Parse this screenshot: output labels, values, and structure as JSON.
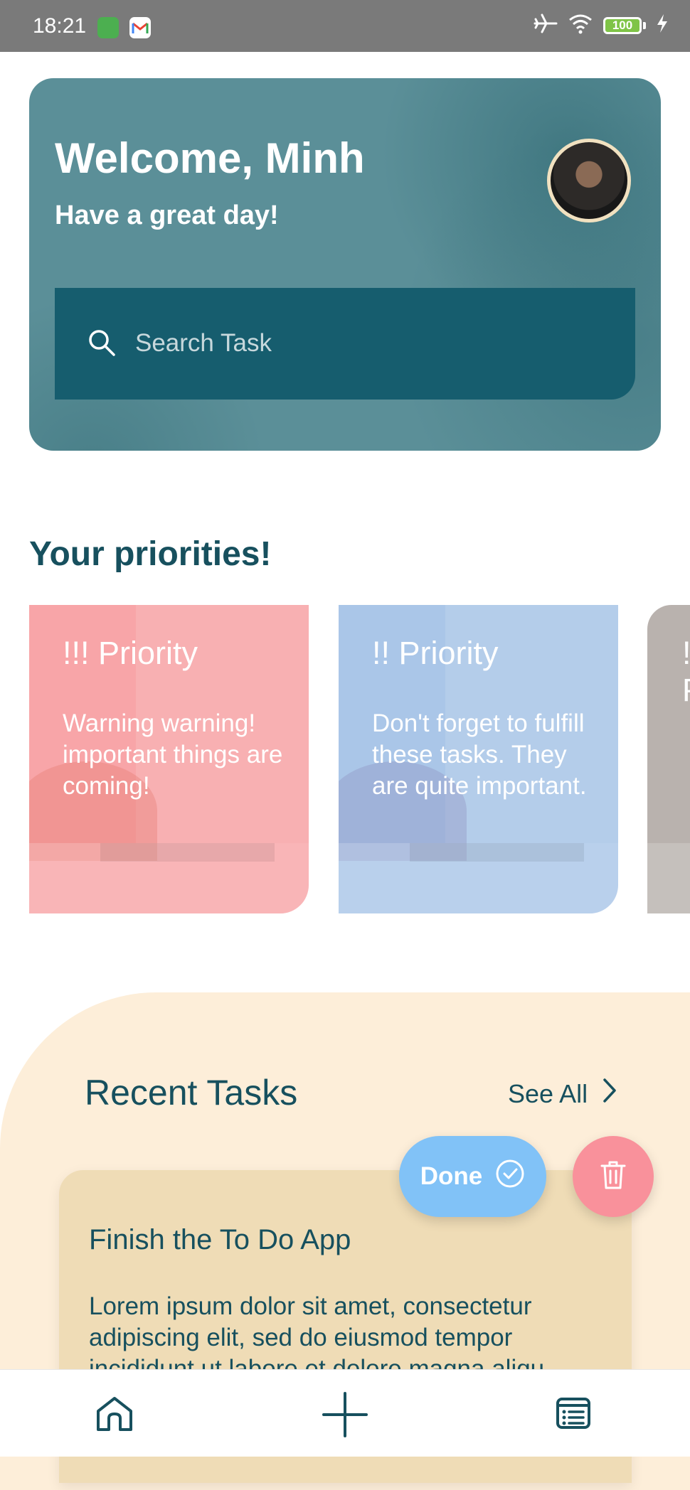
{
  "status_bar": {
    "time": "18:21",
    "battery": "100",
    "icons": [
      "app-notification-icon",
      "gmail-icon",
      "airplane-icon",
      "wifi-icon",
      "battery-icon",
      "charging-icon"
    ]
  },
  "header": {
    "welcome": "Welcome, Minh",
    "greeting": "Have a great day!",
    "avatar_icon": "user-avatar",
    "search": {
      "placeholder": "Search Task",
      "icon": "search-icon"
    }
  },
  "priorities": {
    "title": "Your priorities!",
    "cards": [
      {
        "title": "!!! Priority",
        "body": "Warning warning! important things are coming!",
        "color": "#f8a5a8"
      },
      {
        "title": "!! Priority",
        "body": "Don't forget to fulfill these tasks. They are quite important.",
        "color": "#aac6e8"
      },
      {
        "title": "! Priority",
        "body": "",
        "color": "#b9b2ae"
      }
    ]
  },
  "recent_tasks": {
    "title": "Recent Tasks",
    "see_all": "See All",
    "done_label": "Done",
    "task": {
      "title": "Finish the To Do App",
      "body": "Lorem ipsum dolor sit amet, consectetur adipiscing elit, sed do eiusmod tempor incididunt ut labore et dolore magna aliqu"
    }
  },
  "bottom_nav": {
    "items": [
      {
        "name": "home",
        "icon": "home-icon"
      },
      {
        "name": "add",
        "icon": "plus-icon"
      },
      {
        "name": "tasks",
        "icon": "list-icon"
      }
    ]
  },
  "colors": {
    "primary": "#17505e",
    "header_bg": "#5b8f98",
    "search_bg": "#165d6e",
    "recent_bg": "#fdeed9",
    "task_card": "#efdcb6",
    "done": "#81c2f7",
    "delete": "#f9919b"
  }
}
